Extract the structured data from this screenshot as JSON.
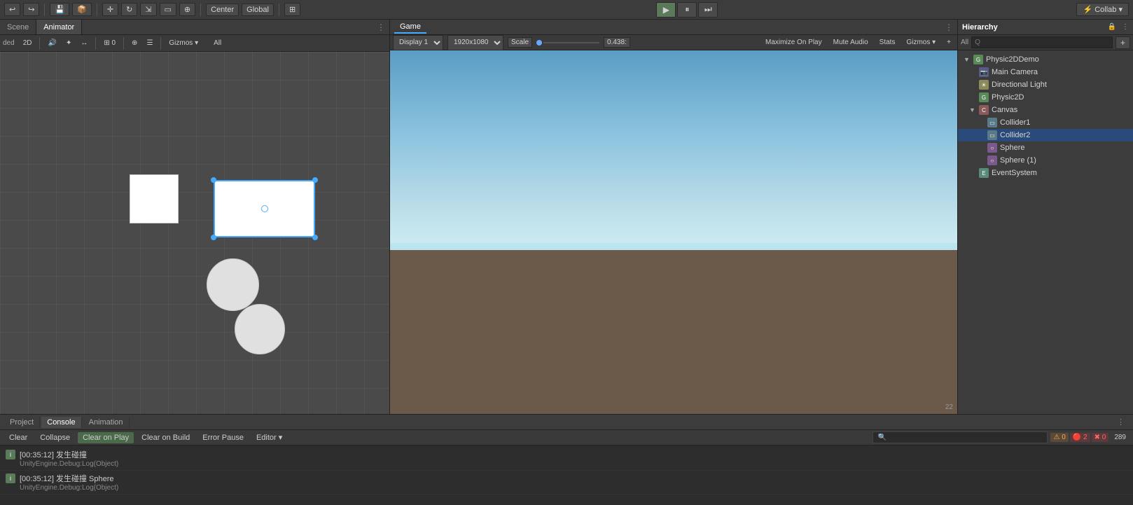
{
  "toolbar": {
    "undo_label": "↩",
    "redo_label": "↪",
    "save_label": "💾",
    "center_label": "Center",
    "global_label": "Global",
    "play_label": "▶",
    "pause_label": "⏸",
    "step_label": "⏭",
    "collab_label": "⚡ Collab ▾"
  },
  "scene_panel": {
    "tab_scene": "Scene",
    "tab_animator": "Animator",
    "toolbar_2d": "2D",
    "toolbar_gizmos": "Gizmos ▾",
    "toolbar_all": "All"
  },
  "game_panel": {
    "tab_label": "Game",
    "display_label": "Display 1",
    "resolution_label": "1920x1080",
    "scale_label": "Scale",
    "scale_value": "0.438:",
    "maximize_label": "Maximize On Play",
    "mute_label": "Mute Audio",
    "stats_label": "Stats",
    "gizmos_label": "Gizmos ▾",
    "plus_label": "+",
    "more_label": "⋮"
  },
  "hierarchy": {
    "tab_label": "Hierarchy",
    "all_label": "All",
    "lock_label": "🔒",
    "search_placeholder": "Q",
    "items": [
      {
        "id": "physic2ddemo",
        "label": "Physic2DDemo",
        "level": 0,
        "expanded": true,
        "icon": "game"
      },
      {
        "id": "main-camera",
        "label": "Main Camera",
        "level": 1,
        "icon": "camera"
      },
      {
        "id": "directional-light",
        "label": "Directional Light",
        "level": 1,
        "icon": "light"
      },
      {
        "id": "physic2d",
        "label": "Physic2D",
        "level": 1,
        "icon": "game"
      },
      {
        "id": "canvas",
        "label": "Canvas",
        "level": 1,
        "expanded": true,
        "icon": "canvas"
      },
      {
        "id": "collider1",
        "label": "Collider1",
        "level": 2,
        "icon": "collider"
      },
      {
        "id": "collider2",
        "label": "Collider2",
        "level": 2,
        "icon": "collider",
        "selected": true
      },
      {
        "id": "sphere",
        "label": "Sphere",
        "level": 2,
        "icon": "sphere"
      },
      {
        "id": "sphere1",
        "label": "Sphere (1)",
        "level": 2,
        "icon": "sphere"
      },
      {
        "id": "eventsystem",
        "label": "EventSystem",
        "level": 1,
        "icon": "event"
      }
    ]
  },
  "bottom": {
    "tab_project": "Project",
    "tab_console": "Console",
    "tab_animation": "Animation",
    "console_clear": "Clear",
    "console_collapse": "Collapse",
    "console_clear_on_play": "Clear on Play",
    "console_clear_on_build": "Clear on Build",
    "console_error_pause": "Error Pause",
    "console_editor_label": "Editor ▾",
    "badge_errors": "2",
    "badge_warnings": "0",
    "badge_messages": "0",
    "count_label": "289",
    "log_entries": [
      {
        "main": "[00:35:12] 发生碰撞",
        "sub": "UnityEngine.Debug:Log(Object)"
      },
      {
        "main": "[00:35:12] 发生碰撞 Sphere",
        "sub": "UnityEngine.Debug:Log(Object)"
      }
    ]
  }
}
